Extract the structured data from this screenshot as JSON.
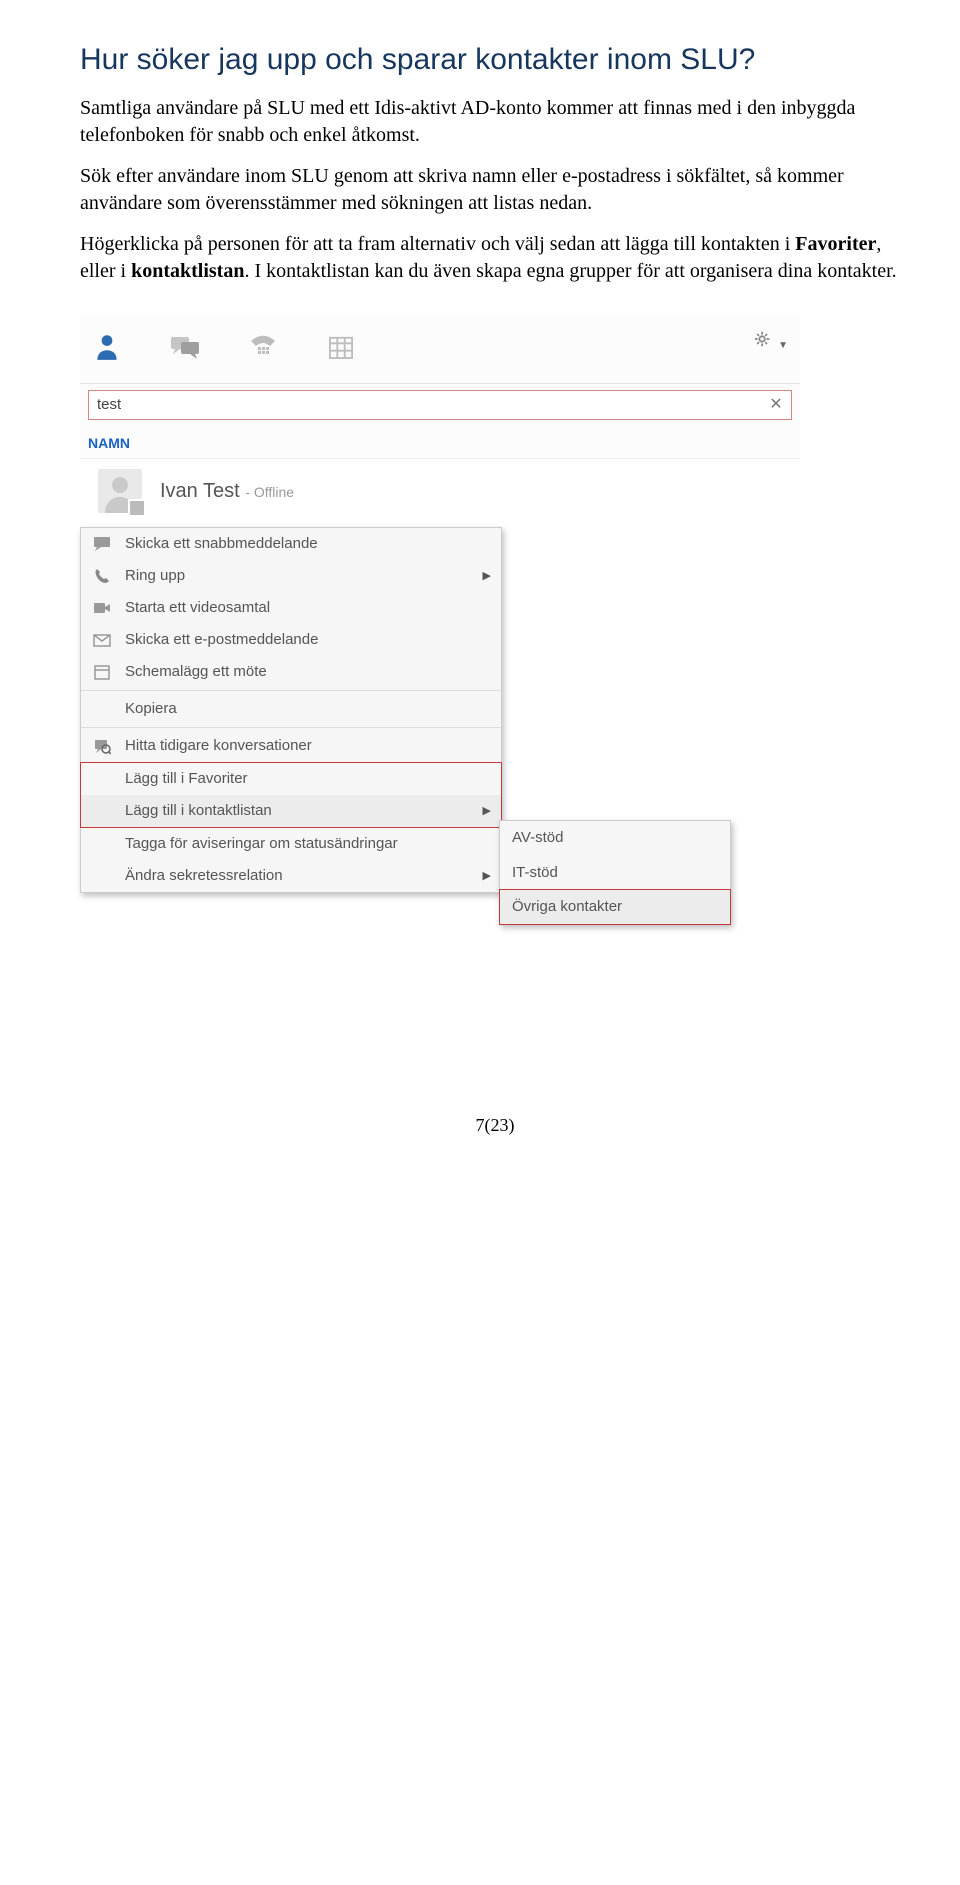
{
  "doc": {
    "heading": "Hur söker jag upp och sparar kontakter inom SLU?",
    "p1": "Samtliga användare på SLU med ett Idis-aktivt AD-konto kommer att finnas med i den inbyggda telefonboken för snabb och enkel åtkomst.",
    "p2": "Sök efter användare inom SLU genom att skriva namn eller e-postadress i sökfältet, så kommer användare som överensstämmer med sökningen att listas nedan.",
    "p3_a": "Högerklicka på personen för att ta fram alternativ och välj sedan att lägga till kontakten i ",
    "p3_b": "Favoriter",
    "p3_c": ", eller i ",
    "p3_d": "kontaktlistan",
    "p3_e": ". I kontaktlistan kan du även skapa egna grupper för att organisera dina kontakter."
  },
  "app": {
    "search_value": "test",
    "group_label": "NAMN",
    "result": {
      "name": "Ivan Test",
      "status": "Offline"
    },
    "context_menu": [
      {
        "icon": "chat",
        "label": "Skicka ett snabbmeddelande"
      },
      {
        "icon": "phone",
        "label": "Ring upp",
        "arrow": true
      },
      {
        "icon": "video",
        "label": "Starta ett videosamtal"
      },
      {
        "icon": "mail",
        "label": "Skicka ett e-postmeddelande"
      },
      {
        "icon": "calendar",
        "label": "Schemalägg ett möte"
      },
      {
        "icon": "",
        "label": "Kopiera"
      },
      {
        "icon": "history",
        "label": "Hitta tidigare konversationer"
      }
    ],
    "fav_label": "Lägg till i Favoriter",
    "add_label": "Lägg till i kontaktlistan",
    "tag_label": "Tagga för aviseringar om statusändringar",
    "priv_label": "Ändra sekretessrelation",
    "submenu": [
      "AV-stöd",
      "IT-stöd",
      "Övriga kontakter"
    ]
  },
  "footer": "7(23)"
}
